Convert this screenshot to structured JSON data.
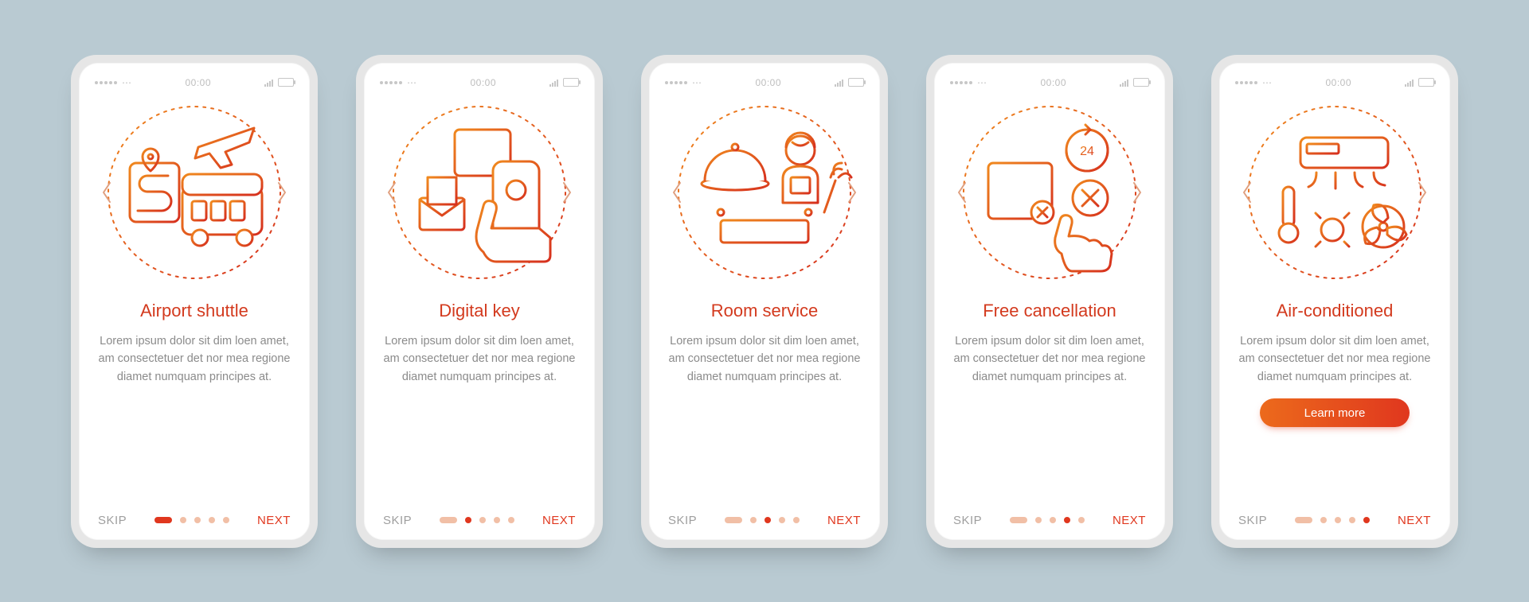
{
  "status_bar": {
    "time": "00:00"
  },
  "actions": {
    "skip": "SKIP",
    "next": "NEXT",
    "learn_more": "Learn more"
  },
  "pager_total": 5,
  "screens": [
    {
      "title": "Airport shuttle",
      "desc": "Lorem ipsum dolor sit dim loen amet, am consectetuer det nor mea regione diamet numquam principes at.",
      "active_index": 0,
      "has_cta": false
    },
    {
      "title": "Digital key",
      "desc": "Lorem ipsum dolor sit dim loen amet, am consectetuer det nor mea regione diamet numquam principes at.",
      "active_index": 1,
      "has_cta": false
    },
    {
      "title": "Room service",
      "desc": "Lorem ipsum dolor sit dim loen amet, am consectetuer det nor mea regione diamet numquam principes at.",
      "active_index": 2,
      "has_cta": false
    },
    {
      "title": "Free cancellation",
      "desc": "Lorem ipsum dolor sit dim loen amet, am consectetuer det nor mea regione diamet numquam principes at.",
      "active_index": 3,
      "has_cta": false
    },
    {
      "title": "Air-conditioned",
      "desc": "Lorem ipsum dolor sit dim loen amet, am consectetuer det nor mea regione diamet numquam principes at.",
      "active_index": 4,
      "has_cta": true
    }
  ]
}
